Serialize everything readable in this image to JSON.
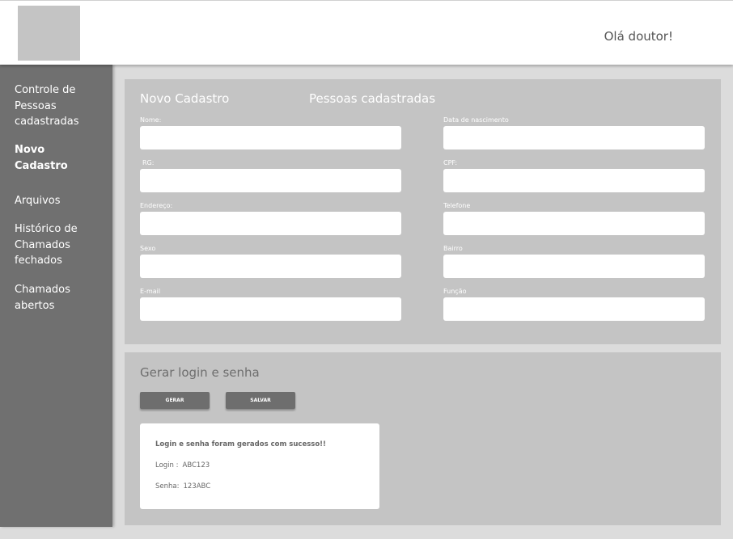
{
  "header": {
    "greeting": "Olá doutor!"
  },
  "sidebar": {
    "items": [
      {
        "label": "Controle de Pessoas cadastradas",
        "active": false
      },
      {
        "label": "Novo Cadastro",
        "active": true
      },
      {
        "label": "Arquivos",
        "active": false
      },
      {
        "label": "Histórico de Chamados fechados",
        "active": false
      },
      {
        "label": "Chamados abertos",
        "active": false
      }
    ]
  },
  "form": {
    "tabs": [
      "Novo Cadastro",
      "Pessoas cadastradas"
    ],
    "fields": [
      {
        "label": "Nome:",
        "value": ""
      },
      {
        "label": "Data de nascimento",
        "value": ""
      },
      {
        "label": "RG:",
        "value": ""
      },
      {
        "label": "CPF:",
        "value": ""
      },
      {
        "label": "Endereço:",
        "value": ""
      },
      {
        "label": "Telefone",
        "value": ""
      },
      {
        "label": "Sexo",
        "value": ""
      },
      {
        "label": "Bairro",
        "value": ""
      },
      {
        "label": "E-mail",
        "value": ""
      },
      {
        "label": "Função",
        "value": ""
      }
    ]
  },
  "login": {
    "title": "Gerar login e senha",
    "generate_label": "GERAR",
    "save_label": "SALVAR",
    "result": {
      "message": "Login e senha foram gerados com sucesso!!",
      "login_label": "Login :",
      "login_value": "ABC123",
      "password_label": "Senha:",
      "password_value": "123ABC"
    }
  }
}
